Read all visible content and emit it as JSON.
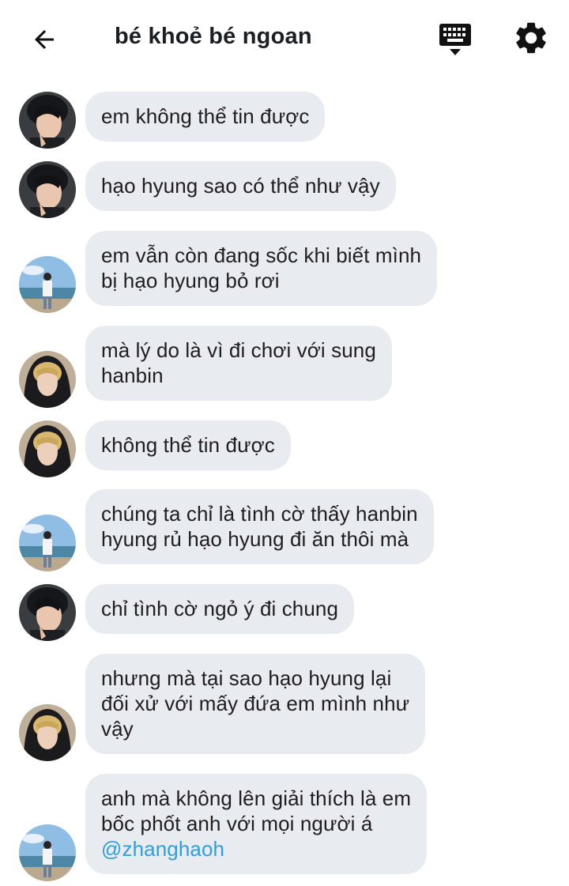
{
  "header": {
    "title": "bé khoẻ bé ngoan",
    "back_icon": "arrow-left-icon",
    "keyboard_icon": "keyboard-icon",
    "settings_icon": "gear-icon"
  },
  "colors": {
    "bubble_bg": "#e8ebef",
    "text": "#1c1e21",
    "mention": "#2e9fdc"
  },
  "messages": [
    {
      "avatar": "dark-hair-selfie",
      "text": "em không thể tin được"
    },
    {
      "avatar": "dark-hair-selfie",
      "text": "hạo hyung sao có thể như vậy"
    },
    {
      "avatar": "beach-photo",
      "text": "em vẫn còn đang sốc khi biết mình\nbị hạo hyung bỏ rơi"
    },
    {
      "avatar": "blonde-hoodie",
      "text": "mà lý do là vì đi chơi với sung\nhanbin"
    },
    {
      "avatar": "blonde-hoodie",
      "text": "không thể tin được"
    },
    {
      "avatar": "beach-photo",
      "text": "chúng ta chỉ là tình cờ thấy hanbin\nhyung rủ hạo hyung đi ăn thôi mà"
    },
    {
      "avatar": "dark-hair-selfie",
      "text": "chỉ tình cờ ngỏ ý đi chung"
    },
    {
      "avatar": "blonde-hoodie",
      "text": "nhưng mà tại sao hạo hyung lại\nđối xử với mấy đứa em mình như\nvậy"
    },
    {
      "avatar": "beach-photo",
      "text": "anh mà không lên giải thích là em\nbốc phốt anh với mọi người á",
      "mention": "@zhanghaoh"
    }
  ]
}
